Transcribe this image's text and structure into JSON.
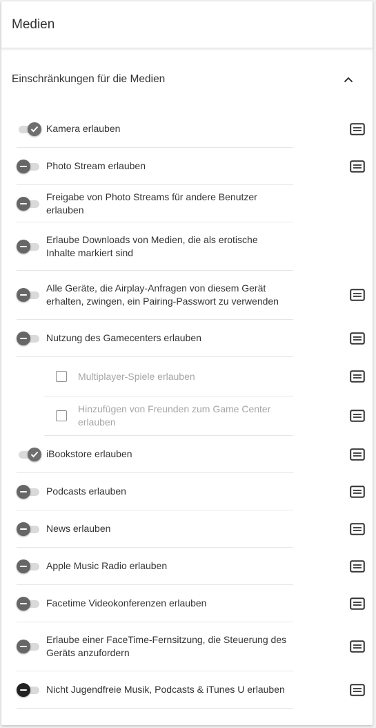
{
  "header": {
    "title": "Medien"
  },
  "section": {
    "title": "Einschränkungen für die Medien"
  },
  "items": [
    {
      "label": "Kamera erlauben",
      "state": "on",
      "doc": true
    },
    {
      "label": "Photo Stream erlauben",
      "state": "off",
      "doc": true
    },
    {
      "label": "Freigabe von Photo Streams für andere Benutzer erlauben",
      "state": "off",
      "doc": false
    },
    {
      "label": "Erlaube Downloads von Medien, die als erotische Inhalte markiert sind",
      "state": "off",
      "doc": false
    },
    {
      "label": "Alle Geräte, die Airplay-Anfragen von diesem Gerät erhalten, zwingen, ein Pairing-Passwort zu verwenden",
      "state": "off",
      "doc": true
    },
    {
      "label": "Nutzung des Gamecenters erlauben",
      "state": "off",
      "doc": true
    },
    {
      "label": "Multiplayer-Spiele erlauben",
      "type": "checkbox",
      "checked": false,
      "doc": true
    },
    {
      "label": "Hinzufügen von Freunden zum Game Center erlauben",
      "type": "checkbox",
      "checked": false,
      "doc": true
    },
    {
      "label": "iBookstore erlauben",
      "state": "on",
      "doc": true
    },
    {
      "label": "Podcasts erlauben",
      "state": "off",
      "doc": true
    },
    {
      "label": "News erlauben",
      "state": "off",
      "doc": true
    },
    {
      "label": "Apple Music Radio erlauben",
      "state": "off",
      "doc": true
    },
    {
      "label": "Facetime Videokonferenzen erlauben",
      "state": "off",
      "doc": true
    },
    {
      "label": "Erlaube einer FaceTime-Fernsitzung, die Steuerung des Geräts anzufordern",
      "state": "off",
      "doc": true
    },
    {
      "label": "Nicht Jugendfreie Musik, Podcasts & iTunes U erlauben",
      "state": "off",
      "dark": true,
      "doc": true
    }
  ]
}
